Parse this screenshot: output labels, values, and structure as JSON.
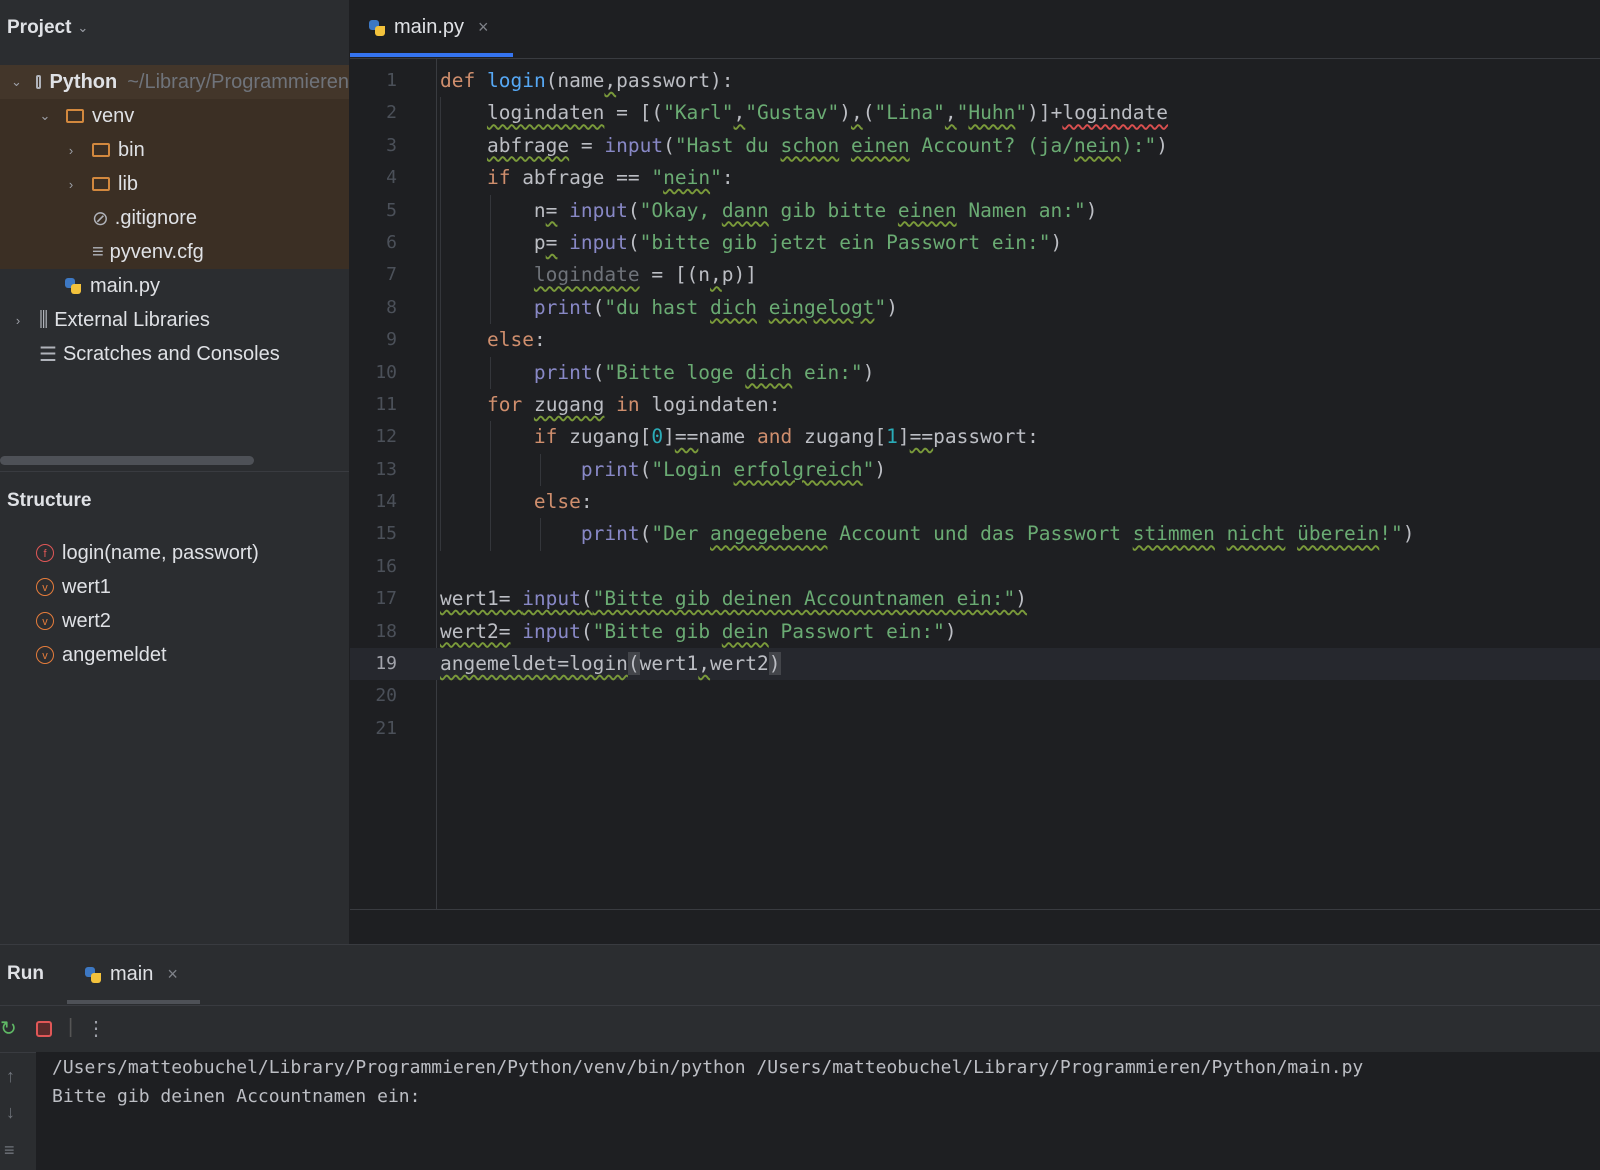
{
  "project": {
    "title": "Project",
    "tree": [
      {
        "label": "Python",
        "extra": "~/Library/Programmieren"
      },
      {
        "label": "venv"
      },
      {
        "label": "bin"
      },
      {
        "label": "lib"
      },
      {
        "label": ".gitignore"
      },
      {
        "label": "pyvenv.cfg"
      },
      {
        "label": "main.py"
      },
      {
        "label": "External Libraries"
      },
      {
        "label": "Scratches and Consoles"
      }
    ]
  },
  "structure": {
    "title": "Structure",
    "items": [
      {
        "badge": "f",
        "label": "login(name, passwort)"
      },
      {
        "badge": "v",
        "label": "wert1"
      },
      {
        "badge": "v",
        "label": "wert2"
      },
      {
        "badge": "v",
        "label": "angemeldet"
      }
    ]
  },
  "editor": {
    "tab_label": "main.py",
    "close_glyph": "×",
    "line_numbers": [
      "1",
      "2",
      "3",
      "4",
      "5",
      "6",
      "7",
      "8",
      "9",
      "10",
      "11",
      "12",
      "13",
      "14",
      "15",
      "16",
      "17",
      "18",
      "19",
      "20",
      "21"
    ]
  },
  "run": {
    "title": "Run",
    "tab_label": "main",
    "close_glyph": "×",
    "console_lines": [
      "/Users/matteobuchel/Library/Programmieren/Python/venv/bin/python /Users/matteobuchel/Library/Programmieren/Python/main.py",
      "Bitte gib deinen Accountnamen ein:"
    ]
  },
  "icons": {
    "project_chevron": "chevron-down-icon",
    "rerun": "rerun-icon",
    "stop": "stop-icon",
    "more": "more-vertical-icon"
  },
  "colors": {
    "keyword": "#cf8e6d",
    "function": "#56a8f5",
    "builtin": "#8888c6",
    "string": "#6aab73",
    "number": "#2aacb8",
    "accent": "#3574f0"
  }
}
